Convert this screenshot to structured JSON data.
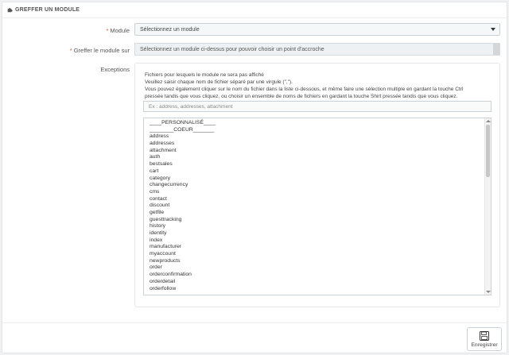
{
  "panel": {
    "title": "GREFFER UN MODULE",
    "icon": "puzzle-icon"
  },
  "form": {
    "module": {
      "label": "Module",
      "value": "Sélectionnez un module"
    },
    "hook": {
      "label": "Greffer le module sur",
      "value": "Sélectionnez un module ci-dessus pour pouvoir choisir un point d'accroche"
    },
    "exceptions": {
      "label": "Exceptions",
      "help": [
        "Fichiers pour lesquels le module ne sera pas affiché",
        "Veuillez saisir chaque nom de fichier séparé par une virgule (\",\").",
        "Vous pouvez également cliquer sur le nom du fichier dans la liste ci-dessous, et même faire une sélection multiple en gardant la touche Ctrl",
        "pressée tandis que vous cliquez, ou choisir un ensemble de noms de fichiers en gardant la touche Shirt pressée tandis que vous cliquez."
      ],
      "placeholder": "Ex : address, addresses, attachment",
      "list": [
        "____PERSONNALISÉ____",
        "________COEUR_______",
        "address",
        "addresses",
        "attachment",
        "auth",
        "bestsales",
        "cart",
        "category",
        "changecurrency",
        "cms",
        "contact",
        "discount",
        "getfile",
        "guesttracking",
        "history",
        "identity",
        "index",
        "manufacturer",
        "myaccount",
        "newproducts",
        "order",
        "orderconfirmation",
        "orderdetail",
        "orderfollow"
      ]
    }
  },
  "footer": {
    "save_label": "Enregistrer",
    "save_icon": "floppy-disk-icon"
  },
  "colors": {
    "required": "#e04d3c",
    "page_bg": "#eff1f2"
  }
}
